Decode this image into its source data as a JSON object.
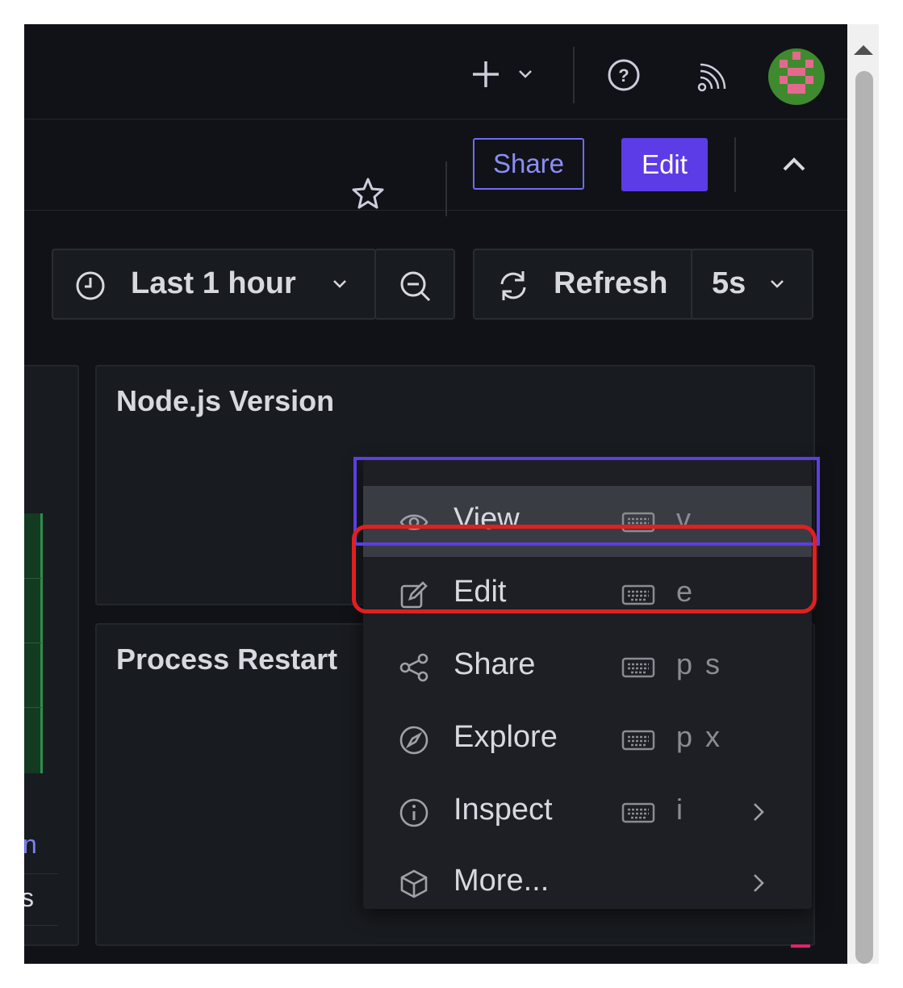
{
  "header": {
    "new_icon": "plus-icon",
    "help_icon": "help-circle-icon",
    "news_icon": "rss-icon",
    "avatar_icon": "user-avatar"
  },
  "toolbar": {
    "star_icon": "star-icon",
    "share_label": "Share",
    "edit_label": "Edit",
    "collapse_icon": "chevron-up-icon"
  },
  "controls": {
    "time_range": "Last 1 hour",
    "refresh_label": "Refresh",
    "refresh_interval": "5s"
  },
  "panels": {
    "left_fragment_1": "n",
    "left_fragment_2": "s",
    "nodejs_title": "Node.js Version",
    "process_title": "Process Restart"
  },
  "context_menu": {
    "items": [
      {
        "label": "View",
        "icon": "eye-icon",
        "shortcut": "v",
        "highlighted": true,
        "submenu": false
      },
      {
        "label": "Edit",
        "icon": "edit-icon",
        "shortcut": "e",
        "highlighted": false,
        "submenu": false
      },
      {
        "label": "Share",
        "icon": "share-icon",
        "shortcut": "p s",
        "highlighted": false,
        "submenu": false
      },
      {
        "label": "Explore",
        "icon": "compass-icon",
        "shortcut": "p x",
        "highlighted": false,
        "submenu": false
      },
      {
        "label": "Inspect",
        "icon": "info-icon",
        "shortcut": "i",
        "highlighted": false,
        "submenu": true
      },
      {
        "label": "More...",
        "icon": "cube-icon",
        "shortcut": "",
        "highlighted": false,
        "submenu": true
      }
    ]
  },
  "colors": {
    "background": "#111217",
    "panel": "#181b1f",
    "accent": "#5c3ce6",
    "annotation": "#e02020"
  }
}
